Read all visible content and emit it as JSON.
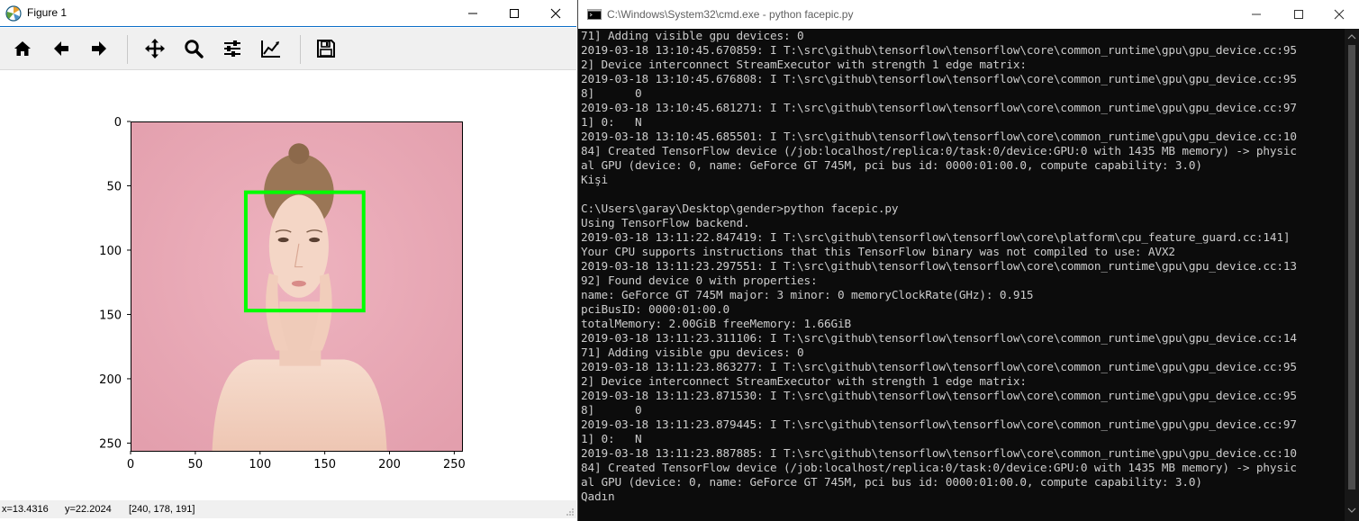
{
  "figure": {
    "title": "Figure 1",
    "toolbar": [
      {
        "name": "home-icon"
      },
      {
        "name": "back-arrow-icon"
      },
      {
        "name": "forward-arrow-icon"
      },
      {
        "name": "pan-icon"
      },
      {
        "name": "zoom-icon"
      },
      {
        "name": "configure-subplots-icon"
      },
      {
        "name": "edit-axis-icon"
      },
      {
        "name": "save-icon"
      }
    ],
    "status": {
      "x": "x=13.4316",
      "y": "y=22.2024",
      "rgb": "[240, 178, 191]"
    }
  },
  "chart_data": {
    "type": "image",
    "xlim": [
      0,
      256
    ],
    "ylim": [
      256,
      0
    ],
    "xticks": [
      0,
      50,
      100,
      150,
      200,
      250
    ],
    "yticks": [
      0,
      50,
      100,
      150,
      200,
      250
    ],
    "face_box": {
      "x0": 89,
      "y0": 55,
      "x1": 180,
      "y1": 147,
      "color": "#00ff00"
    }
  },
  "console": {
    "title": "C:\\Windows\\System32\\cmd.exe - python  facepic.py",
    "lines": [
      "71] Adding visible gpu devices: 0",
      "2019-03-18 13:10:45.670859: I T:\\src\\github\\tensorflow\\tensorflow\\core\\common_runtime\\gpu\\gpu_device.cc:95",
      "2] Device interconnect StreamExecutor with strength 1 edge matrix:",
      "2019-03-18 13:10:45.676808: I T:\\src\\github\\tensorflow\\tensorflow\\core\\common_runtime\\gpu\\gpu_device.cc:95",
      "8]      0",
      "2019-03-18 13:10:45.681271: I T:\\src\\github\\tensorflow\\tensorflow\\core\\common_runtime\\gpu\\gpu_device.cc:97",
      "1] 0:   N",
      "2019-03-18 13:10:45.685501: I T:\\src\\github\\tensorflow\\tensorflow\\core\\common_runtime\\gpu\\gpu_device.cc:10",
      "84] Created TensorFlow device (/job:localhost/replica:0/task:0/device:GPU:0 with 1435 MB memory) -> physic",
      "al GPU (device: 0, name: GeForce GT 745M, pci bus id: 0000:01:00.0, compute capability: 3.0)",
      "Kişi",
      "",
      "C:\\Users\\garay\\Desktop\\gender>python facepic.py",
      "Using TensorFlow backend.",
      "2019-03-18 13:11:22.847419: I T:\\src\\github\\tensorflow\\tensorflow\\core\\platform\\cpu_feature_guard.cc:141]",
      "Your CPU supports instructions that this TensorFlow binary was not compiled to use: AVX2",
      "2019-03-18 13:11:23.297551: I T:\\src\\github\\tensorflow\\tensorflow\\core\\common_runtime\\gpu\\gpu_device.cc:13",
      "92] Found device 0 with properties:",
      "name: GeForce GT 745M major: 3 minor: 0 memoryClockRate(GHz): 0.915",
      "pciBusID: 0000:01:00.0",
      "totalMemory: 2.00GiB freeMemory: 1.66GiB",
      "2019-03-18 13:11:23.311106: I T:\\src\\github\\tensorflow\\tensorflow\\core\\common_runtime\\gpu\\gpu_device.cc:14",
      "71] Adding visible gpu devices: 0",
      "2019-03-18 13:11:23.863277: I T:\\src\\github\\tensorflow\\tensorflow\\core\\common_runtime\\gpu\\gpu_device.cc:95",
      "2] Device interconnect StreamExecutor with strength 1 edge matrix:",
      "2019-03-18 13:11:23.871530: I T:\\src\\github\\tensorflow\\tensorflow\\core\\common_runtime\\gpu\\gpu_device.cc:95",
      "8]      0",
      "2019-03-18 13:11:23.879445: I T:\\src\\github\\tensorflow\\tensorflow\\core\\common_runtime\\gpu\\gpu_device.cc:97",
      "1] 0:   N",
      "2019-03-18 13:11:23.887885: I T:\\src\\github\\tensorflow\\tensorflow\\core\\common_runtime\\gpu\\gpu_device.cc:10",
      "84] Created TensorFlow device (/job:localhost/replica:0/task:0/device:GPU:0 with 1435 MB memory) -> physic",
      "al GPU (device: 0, name: GeForce GT 745M, pci bus id: 0000:01:00.0, compute capability: 3.0)",
      "Qadın"
    ]
  },
  "colors": {
    "image_background": "#e9a9b5",
    "skin": "#f2d2c2",
    "hair": "#9a7656",
    "box": "#00ff00",
    "console_bg": "#0c0c0c",
    "console_text": "#cccccc",
    "title_accent": "#0b6dc6"
  }
}
